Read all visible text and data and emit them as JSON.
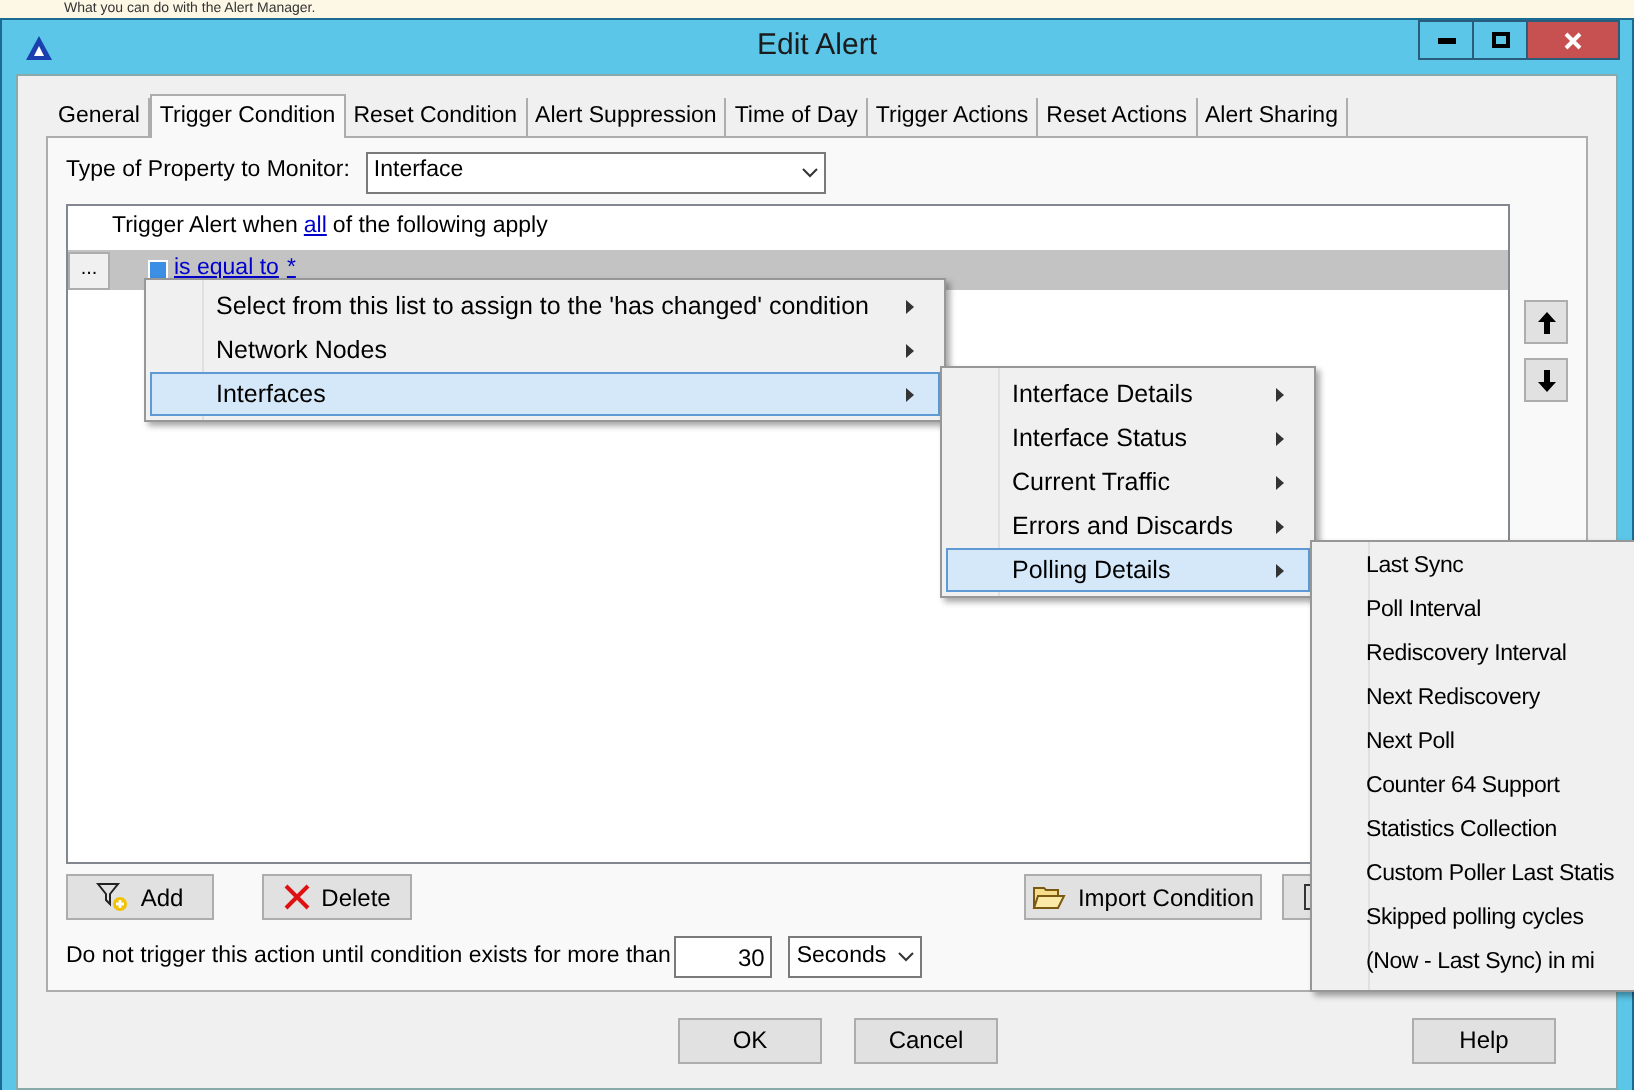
{
  "banner": {
    "text": "What you can do with the Alert Manager."
  },
  "window": {
    "title": "Edit Alert"
  },
  "tabs": [
    {
      "label": "General",
      "selected": false
    },
    {
      "label": "Trigger Condition",
      "selected": true
    },
    {
      "label": "Reset Condition",
      "selected": false
    },
    {
      "label": "Alert Suppression",
      "selected": false
    },
    {
      "label": "Time of Day",
      "selected": false
    },
    {
      "label": "Trigger Actions",
      "selected": false
    },
    {
      "label": "Reset Actions",
      "selected": false
    },
    {
      "label": "Alert Sharing",
      "selected": false
    }
  ],
  "property": {
    "label": "Type of Property to Monitor:",
    "value": "Interface"
  },
  "conditions": {
    "prefix": "Trigger Alert when",
    "link": "all",
    "suffix": "of the following apply",
    "row": {
      "button": "...",
      "operator": "is equal to",
      "value": "*"
    }
  },
  "menus": [
    {
      "items": [
        {
          "label": "Select from this list to assign to the 'has changed' condition",
          "submenu": true,
          "selected": false
        },
        {
          "label": "Network Nodes",
          "submenu": true,
          "selected": false
        },
        {
          "label": "Interfaces",
          "submenu": true,
          "selected": true
        }
      ]
    },
    {
      "items": [
        {
          "label": "Interface Details",
          "submenu": true,
          "selected": false
        },
        {
          "label": "Interface Status",
          "submenu": true,
          "selected": false
        },
        {
          "label": "Current Traffic",
          "submenu": true,
          "selected": false
        },
        {
          "label": "Errors and Discards",
          "submenu": true,
          "selected": false
        },
        {
          "label": "Polling Details",
          "submenu": true,
          "selected": true
        }
      ]
    },
    {
      "items": [
        {
          "label": "Last Sync",
          "submenu": false,
          "selected": false
        },
        {
          "label": "Poll Interval",
          "submenu": false,
          "selected": false
        },
        {
          "label": "Rediscovery Interval",
          "submenu": false,
          "selected": false
        },
        {
          "label": "Next Rediscovery",
          "submenu": false,
          "selected": false
        },
        {
          "label": "Next Poll",
          "submenu": false,
          "selected": false
        },
        {
          "label": "Counter 64 Support",
          "submenu": false,
          "selected": false
        },
        {
          "label": "Statistics Collection",
          "submenu": false,
          "selected": false
        },
        {
          "label": "Custom Poller Last Statis",
          "submenu": false,
          "selected": false
        },
        {
          "label": "Skipped polling cycles",
          "submenu": false,
          "selected": false
        },
        {
          "label": "(Now - Last Sync) in mi",
          "submenu": false,
          "selected": false
        }
      ]
    }
  ],
  "actions": {
    "add": "Add",
    "delete": "Delete",
    "import": "Import Condition"
  },
  "delay": {
    "label": "Do not trigger this action until condition exists for more than",
    "value": "30",
    "unit": "Seconds"
  },
  "footer": {
    "ok": "OK",
    "cancel": "Cancel",
    "help": "Help"
  }
}
